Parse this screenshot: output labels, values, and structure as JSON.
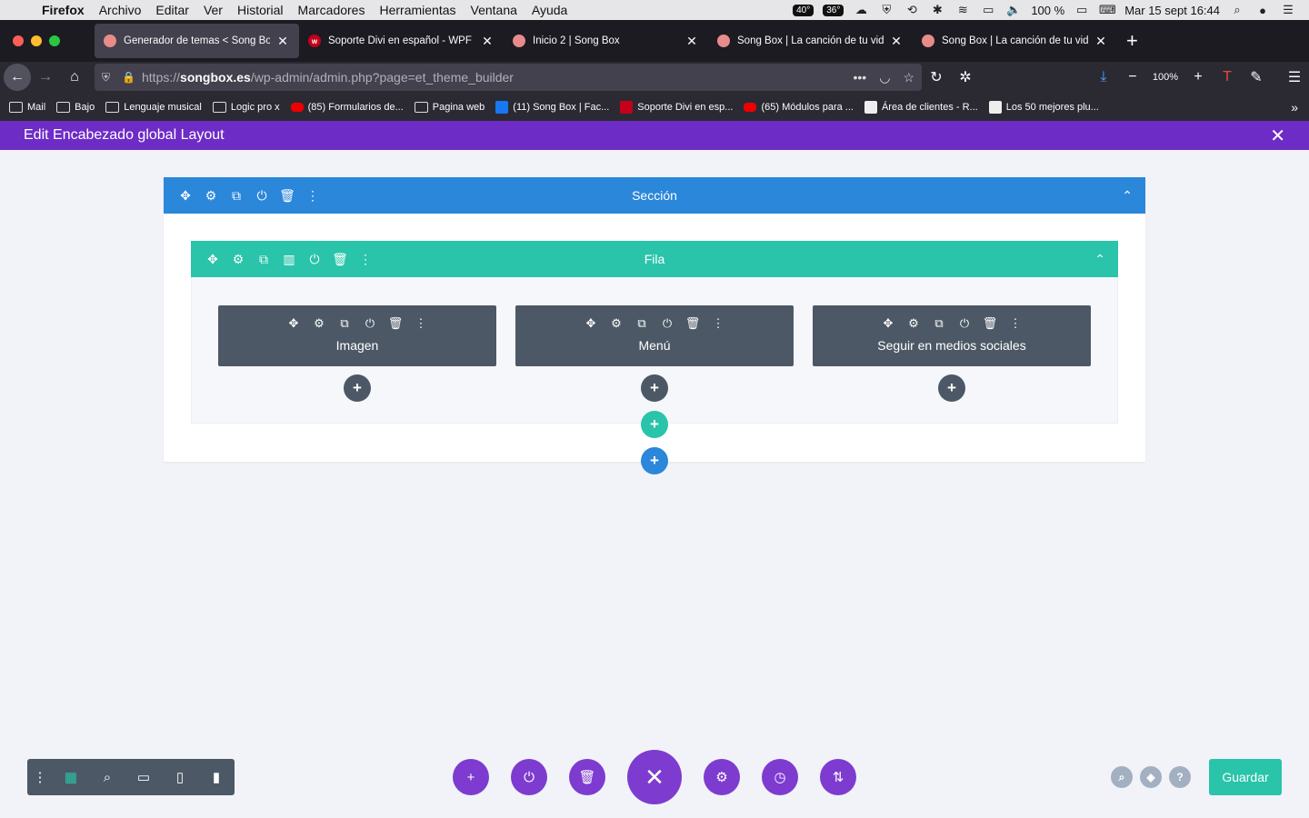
{
  "menubar": {
    "app": "Firefox",
    "items": [
      "Archivo",
      "Editar",
      "Ver",
      "Historial",
      "Marcadores",
      "Herramientas",
      "Ventana",
      "Ayuda"
    ],
    "temp1": "40°",
    "temp2": "36°",
    "battery": "100 %",
    "datetime": "Mar 15 sept  16:44"
  },
  "tabs": [
    {
      "title": "Generador de temas < Song Bo",
      "active": true
    },
    {
      "title": "Soporte Divi en español - WPF",
      "active": false
    },
    {
      "title": "Inicio 2 | Song Box",
      "active": false
    },
    {
      "title": "Song Box | La canción de tu vid",
      "active": false
    },
    {
      "title": "Song Box | La canción de tu vid",
      "active": false
    }
  ],
  "navbar": {
    "url_prefix": "https://",
    "url_host": "songbox.es",
    "url_path": "/wp-admin/admin.php?page=et_theme_builder",
    "zoom": "100%"
  },
  "bookmarks": [
    {
      "label": "Mail",
      "icon": "folder-icon"
    },
    {
      "label": "Bajo",
      "icon": "folder-icon"
    },
    {
      "label": "Lenguaje musical",
      "icon": "folder-icon"
    },
    {
      "label": "Logic pro x",
      "icon": "folder-icon"
    },
    {
      "label": "(85) Formularios de...",
      "icon": "youtube-icon"
    },
    {
      "label": "Pagina web",
      "icon": "folder-icon"
    },
    {
      "label": "(11) Song Box | Fac...",
      "icon": "facebook-icon"
    },
    {
      "label": "Soporte Divi en esp...",
      "icon": "wpf-icon"
    },
    {
      "label": "(65) Módulos para ...",
      "icon": "youtube-icon"
    },
    {
      "label": "Área de clientes - R...",
      "icon": "image-icon"
    },
    {
      "label": "Los 50 mejores plu...",
      "icon": "image-icon"
    }
  ],
  "divibar": {
    "title": "Edit Encabezado global Layout"
  },
  "builder": {
    "section_label": "Sección",
    "row_label": "Fila",
    "modules": [
      {
        "label": "Imagen"
      },
      {
        "label": "Menú"
      },
      {
        "label": "Seguir en medios sociales"
      }
    ]
  },
  "bottom": {
    "save_label": "Guardar"
  },
  "colors": {
    "purple": "#6d2cc5",
    "section_blue": "#2b87da",
    "row_teal": "#29c4a9",
    "module_gray": "#4c5866",
    "save_green": "#29c4a9"
  }
}
